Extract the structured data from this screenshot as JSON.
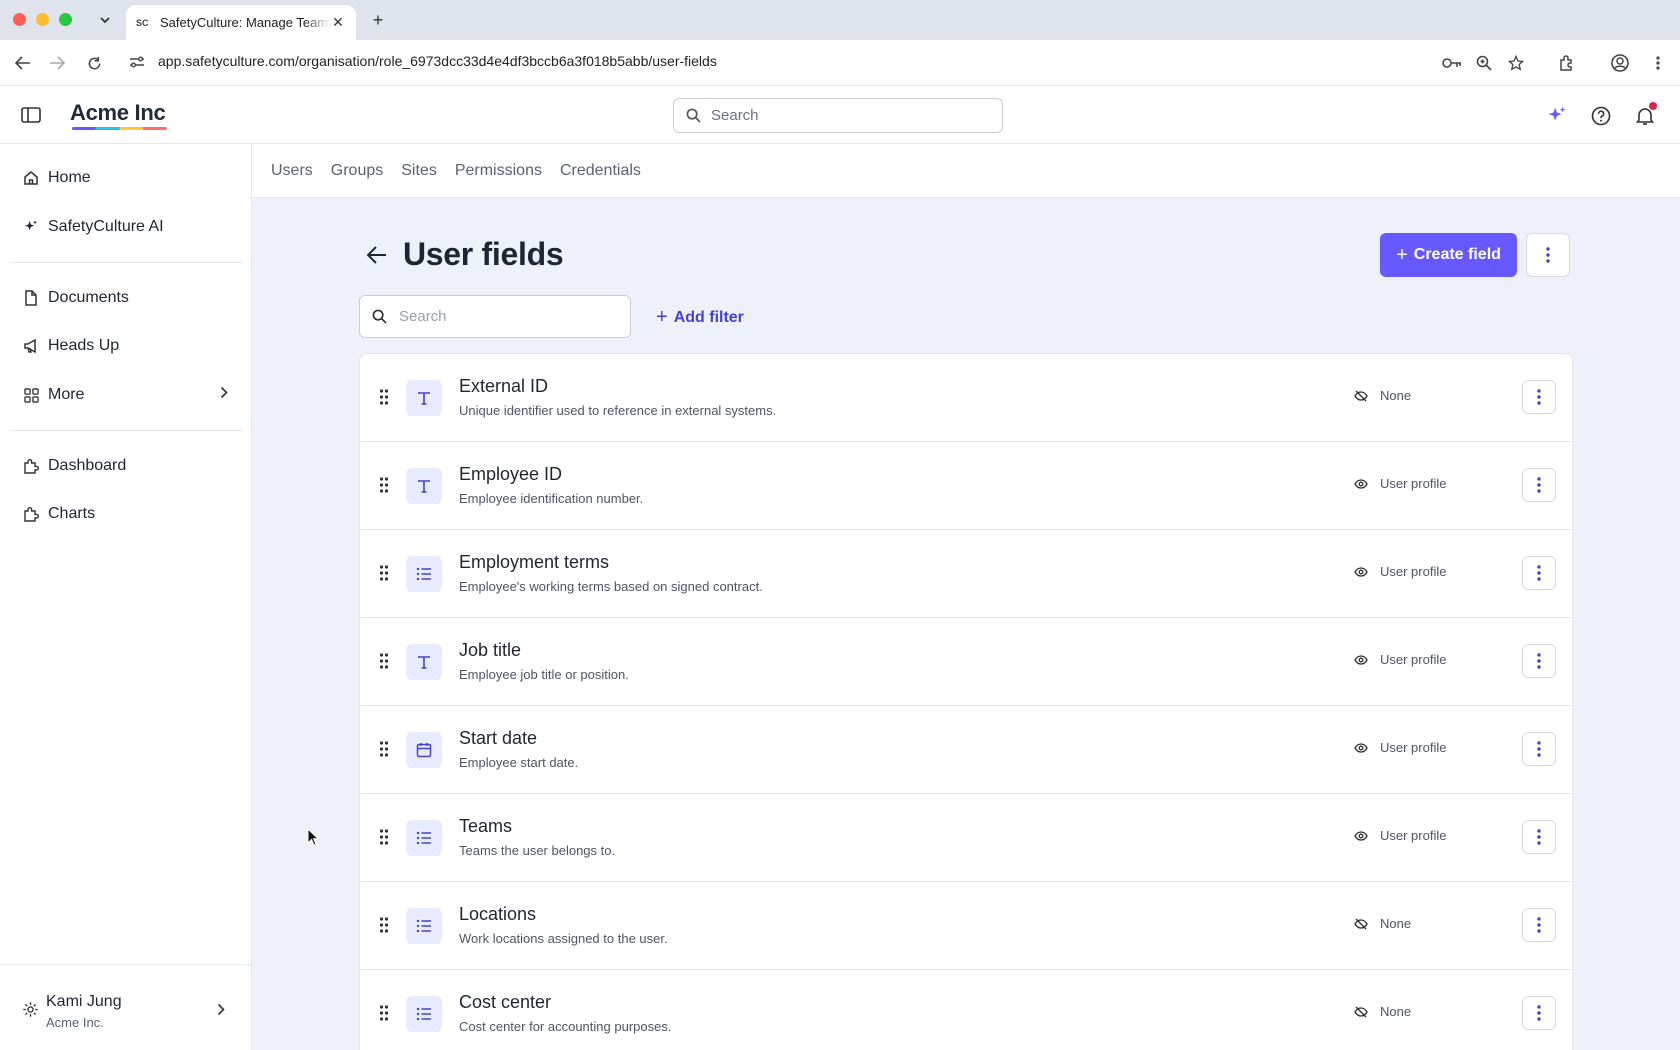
{
  "browser": {
    "tab_title": "SafetyCulture: Manage Teams",
    "favicon_text": "SC",
    "url": "app.safetyculture.com/organisation/role_6973dcc33d4e4df3bccb6a3f018b5abb/user-fields"
  },
  "header": {
    "brand": "Acme Inc",
    "search_placeholder": "Search"
  },
  "sidebar": {
    "items": [
      {
        "label": "Home",
        "icon": "home-icon"
      },
      {
        "label": "SafetyCulture AI",
        "icon": "sparkle-icon"
      },
      {
        "label": "Documents",
        "icon": "document-icon"
      },
      {
        "label": "Heads Up",
        "icon": "megaphone-icon"
      },
      {
        "label": "More",
        "icon": "grid-icon"
      },
      {
        "label": "Dashboard",
        "icon": "puzzle-icon"
      },
      {
        "label": "Charts",
        "icon": "puzzle-icon"
      }
    ],
    "user": {
      "name": "Kami Jung",
      "org": "Acme Inc."
    }
  },
  "subnav": [
    "Users",
    "Groups",
    "Sites",
    "Permissions",
    "Credentials"
  ],
  "page": {
    "title": "User fields",
    "create_label": "Create field",
    "search_placeholder": "Search",
    "add_filter_label": "Add filter"
  },
  "fields": [
    {
      "name": "External ID",
      "description": "Unique identifier used to reference in external systems.",
      "type_icon": "text-icon",
      "visibility": "None",
      "visibility_icon": "eye-off-icon"
    },
    {
      "name": "Employee ID",
      "description": "Employee identification number.",
      "type_icon": "text-icon",
      "visibility": "User profile",
      "visibility_icon": "eye-icon"
    },
    {
      "name": "Employment terms",
      "description": "Employee's working terms based on signed contract.",
      "type_icon": "list-icon",
      "visibility": "User profile",
      "visibility_icon": "eye-icon"
    },
    {
      "name": "Job title",
      "description": "Employee job title or position.",
      "type_icon": "text-icon",
      "visibility": "User profile",
      "visibility_icon": "eye-icon"
    },
    {
      "name": "Start date",
      "description": "Employee start date.",
      "type_icon": "calendar-icon",
      "visibility": "User profile",
      "visibility_icon": "eye-icon"
    },
    {
      "name": "Teams",
      "description": "Teams the user belongs to.",
      "type_icon": "list-icon",
      "visibility": "User profile",
      "visibility_icon": "eye-icon"
    },
    {
      "name": "Locations",
      "description": "Work locations assigned to the user.",
      "type_icon": "list-icon",
      "visibility": "None",
      "visibility_icon": "eye-off-icon"
    },
    {
      "name": "Cost center",
      "description": "Cost center for accounting purposes.",
      "type_icon": "list-icon",
      "visibility": "None",
      "visibility_icon": "eye-off-icon"
    }
  ],
  "colors": {
    "accent": "#6559ff",
    "link": "#4740d4",
    "main_bg": "#eef1f9",
    "notification": "#e0224b"
  }
}
